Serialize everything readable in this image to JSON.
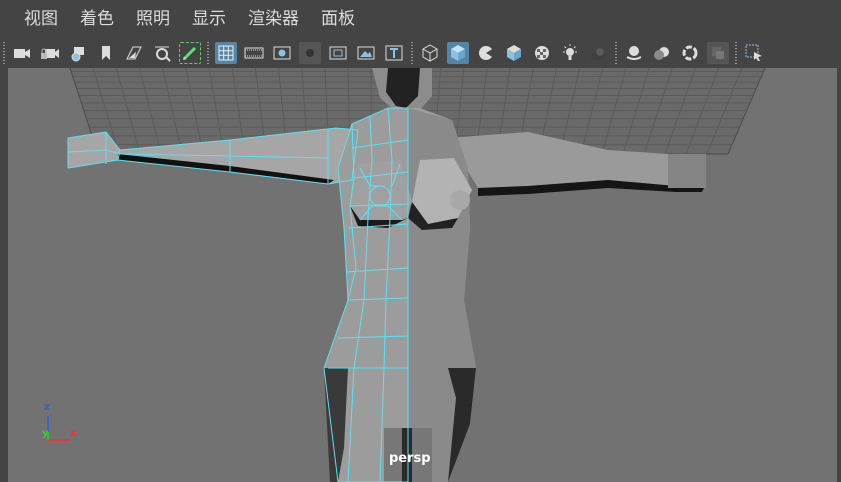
{
  "menubar": {
    "items": [
      "视图",
      "着色",
      "照明",
      "显示",
      "渲染器",
      "面板"
    ]
  },
  "toolbar": {
    "icons": [
      "camera-icon",
      "camera-lock-icon",
      "camera-attributes-icon",
      "bookmark-icon",
      "image-plane-icon",
      "two-d-pan-icon",
      "grease-pencil-icon",
      "grid-icon",
      "film-gate-icon",
      "resolution-gate-icon",
      "gate-mask-icon",
      "field-chart-icon",
      "safe-action-icon",
      "safe-title-icon",
      "wireframe-icon",
      "smooth-shade-icon",
      "wireframe-on-shaded-icon",
      "default-material-icon",
      "textured-icon",
      "use-all-lights-icon",
      "shadows-icon",
      "screen-space-ao-icon",
      "motion-blur-icon",
      "multisample-aa-icon",
      "depth-of-field-icon",
      "isolate-select-icon",
      "xray-icon",
      "viewport-options-icon"
    ],
    "active_color": "#5285a6"
  },
  "viewport": {
    "camera_label": "persp",
    "axis": {
      "x": "x",
      "y": "y",
      "z": "z"
    },
    "background_color": "#727272",
    "wire_color": "#5fe1f0"
  }
}
